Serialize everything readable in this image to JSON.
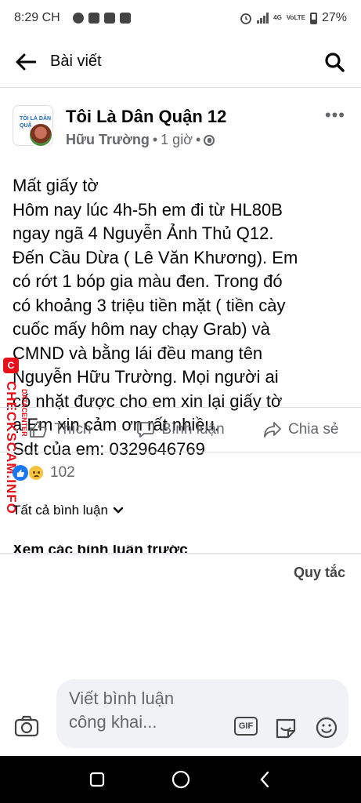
{
  "status_bar": {
    "time": "8:29 CH",
    "battery": "27%",
    "network_labels": [
      "4G",
      "VoLTE"
    ]
  },
  "header": {
    "title": "Bài viết"
  },
  "post": {
    "group_name": "Tôi Là Dân Quận 12",
    "avatar_text": "TÔI LÀ DÂN QUẬ",
    "author": "Hữu Trường",
    "time_separator": "•",
    "time": "1 giờ",
    "privacy_separator": "•",
    "more": "•••",
    "body_lines": [
      "Mất giấy tờ",
      "Hôm nay lúc 4h-5h em đi từ HL80B",
      "ngay ngã 4 Nguyễn Ảnh Thủ Q12.",
      "Đến Cầu Dừa ( Lê Văn Khương). Em",
      "có rớt 1 bóp gia màu đen. Trong đó",
      "có khoảng 3 triệu tiền mặt ( tiền cày",
      "cuốc mấy hôm nay chạy Grab) và",
      "CMND và bằng lái đều mang tên",
      "Nguyễn Hữu Trường. Mọi người ai",
      "có nhặt được cho em xin lại giấy tờ",
      "ạ Em xin cảm ơn rất nhiều.",
      "Sdt của em: 0329646769"
    ]
  },
  "actions": {
    "like": "Thích",
    "comment": "Bình luận",
    "share": "Chia sẻ"
  },
  "reactions": {
    "count": "102"
  },
  "comments": {
    "filter": "Tất cả bình luận",
    "previous": "Xem các bình luận trước",
    "rules": "Quy tắc",
    "placeholder": "Viết bình luận công khai..."
  },
  "watermark": {
    "badge": "C",
    "text": "CHECKSCAM.INFO",
    "small": "DATACENTER"
  },
  "colors": {
    "accent": "#1877f2",
    "secondary_text": "#65676b",
    "watermark": "#e8101a"
  }
}
